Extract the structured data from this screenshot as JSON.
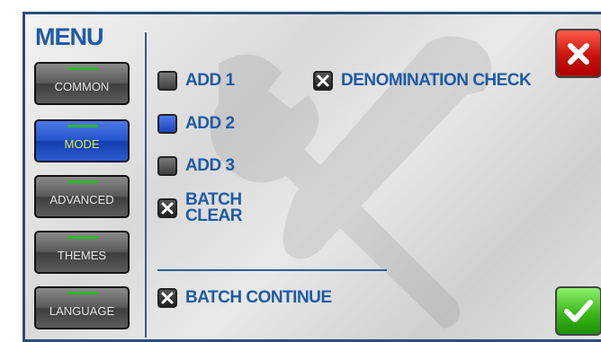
{
  "menu": {
    "title": "MENU",
    "items": [
      {
        "label": "COMMON",
        "active": false
      },
      {
        "label": "MODE",
        "active": true
      },
      {
        "label": "ADVANCED",
        "active": false
      },
      {
        "label": "THEMES",
        "active": false
      },
      {
        "label": "LANGUAGE",
        "active": false
      }
    ]
  },
  "options": {
    "add1": {
      "label": "ADD 1",
      "checked": false
    },
    "add2": {
      "label": "ADD 2",
      "selected": true
    },
    "add3": {
      "label": "ADD 3",
      "checked": false
    },
    "batch_clear": {
      "line1": "BATCH",
      "line2": "CLEAR",
      "checked": true
    },
    "denomination_check": {
      "label": "DENOMINATION CHECK",
      "checked": true
    },
    "batch_continue": {
      "label": "BATCH CONTINUE",
      "checked": true
    }
  },
  "icons": {
    "close": "close-icon",
    "confirm": "checkmark-icon",
    "background": "tools-wrench-hammer-icon"
  },
  "colors": {
    "accent_blue": "#1f5aa8",
    "close_red": "#d81e12",
    "confirm_green": "#3cb81a",
    "active_text": "#d8f04a"
  }
}
